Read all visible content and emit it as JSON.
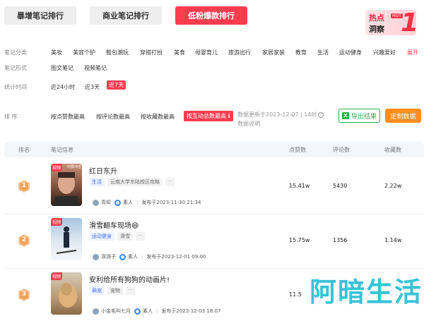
{
  "tabs": [
    "暴增笔记排行",
    "商业笔记排行",
    "低粉爆款排行"
  ],
  "hot_banner": {
    "title": "热点",
    "tag": "HOT",
    "sub": "洞察",
    "digit": "1"
  },
  "filters": {
    "category": {
      "label": "笔记分类",
      "options": [
        "美妆",
        "美容个护",
        "鞋包潮玩",
        "穿搭打扮",
        "美食",
        "母婴育儿",
        "旅游出行",
        "家居家装",
        "教育",
        "生活",
        "运动健身",
        "兴趣爱好"
      ],
      "expand": "展开"
    },
    "form": {
      "label": "笔记形式",
      "options": [
        "图文笔记",
        "视频笔记"
      ]
    },
    "time": {
      "label": "统计时间",
      "options": [
        "近24小时",
        "近3天",
        "近7天"
      ],
      "selected": "近7天"
    }
  },
  "sort": {
    "label": "排   序",
    "options": [
      "按点赞数最高",
      "按评论数最高",
      "按收藏数最高",
      "按互动总数最高"
    ],
    "selected": "按互动总数最高",
    "update": "数据更新于2023-12-07 | 14时",
    "note": "数据说明",
    "export": "导出结果",
    "custom": "定制数据"
  },
  "table": {
    "headers": [
      "排名",
      "笔记信息",
      "点赞数",
      "评论数",
      "收藏数"
    ],
    "rows": [
      {
        "rank": "1",
        "thumb_tag": "视频",
        "thumb_caption": "中群冲击",
        "title": "红日东升",
        "tags": [
          "生活",
          "云南大学东陆校区攻略"
        ],
        "author": "青知",
        "role": "素人",
        "date": "发布于2023-11-30 21:34",
        "likes": "15.41w",
        "comments": "5430",
        "collects": "2.22w"
      },
      {
        "rank": "2",
        "thumb_tag": "视频",
        "thumb_caption": "",
        "title": "滑雪翻车现场😄",
        "tags": [
          "运动健身",
          "滑雪"
        ],
        "author": "湃湃子",
        "role": "素人",
        "date": "发布于2023-12-01 09:00",
        "likes": "15.75w",
        "comments": "1356",
        "collects": "1.14w"
      },
      {
        "rank": "3",
        "thumb_tag": "视频",
        "thumb_caption": "",
        "title": "安利给所有狗狗的动画片!",
        "tags": [
          "萌宠",
          "宠物"
        ],
        "author": "小金毛叫七月",
        "role": "素人",
        "date": "发布于2023-12-03 18:07",
        "likes": "11.5",
        "comments": "",
        "collects": ""
      }
    ]
  },
  "watermark": "阿暗生活",
  "colors": {
    "accent": "#ff3d4f",
    "export": "#2bb24c",
    "custom": "#ff8d1a",
    "tag_blue": "#3d6fff",
    "watermark": "#37c3d6"
  }
}
